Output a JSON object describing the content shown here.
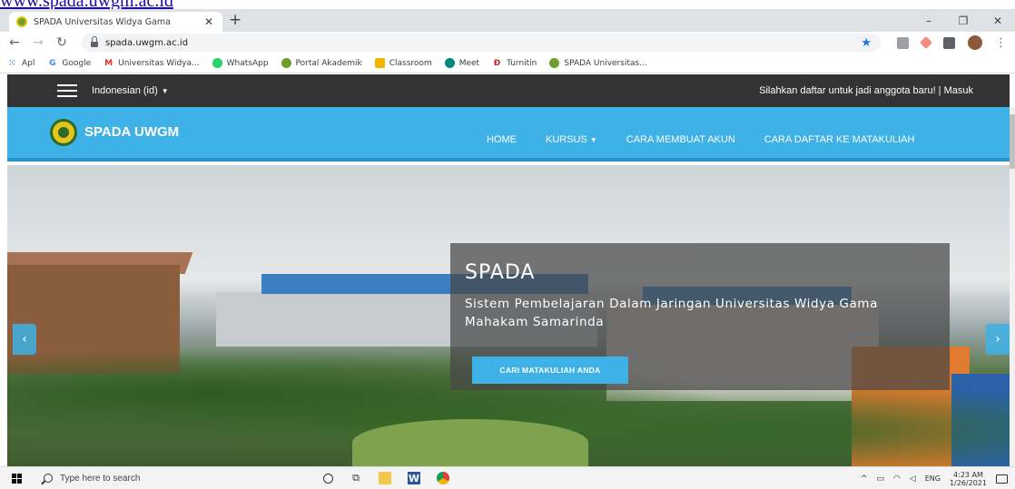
{
  "document": {
    "link_text": "www.spada.uwgm.ac.id"
  },
  "browser": {
    "tab": {
      "title": "SPADA Universitas Widya Gama"
    },
    "window_controls": [
      "–",
      "❐",
      "✕"
    ],
    "url": "spada.uwgm.ac.id",
    "bookmarks": [
      {
        "label": "Apl",
        "icon": "apps-grid-icon",
        "color": "#1a73e8"
      },
      {
        "label": "Google",
        "icon": "google-icon",
        "color": "#4285f4"
      },
      {
        "label": "Universitas Widya...",
        "icon": "gmail-icon",
        "color": "#d93025"
      },
      {
        "label": "WhatsApp",
        "icon": "whatsapp-icon",
        "color": "#25d366"
      },
      {
        "label": "Portal Akademik",
        "icon": "portal-icon",
        "color": "#6f9e2c"
      },
      {
        "label": "Classroom",
        "icon": "classroom-icon",
        "color": "#f2b600"
      },
      {
        "label": "Meet",
        "icon": "meet-icon",
        "color": "#00897b"
      },
      {
        "label": "Turnitin",
        "icon": "turnitin-icon",
        "color": "#c62828"
      },
      {
        "label": "SPADA Universitas...",
        "icon": "spada-icon",
        "color": "#6f9e2c"
      }
    ]
  },
  "site": {
    "topbar": {
      "language": "Indonesian (id)",
      "signup_text": "Silahkan daftar untuk jadi anggota baru! | Masuk"
    },
    "navbar": {
      "brand": "SPADA UWGM",
      "menu": [
        {
          "label": "HOME"
        },
        {
          "label": "KURSUS"
        },
        {
          "label": "CARA MEMBUAT AKUN"
        },
        {
          "label": "CARA DAFTAR KE MATAKULIAH"
        }
      ]
    },
    "hero": {
      "title": "SPADA",
      "subtitle": "Sistem Pembelajaran Dalam Jaringan Universitas Widya Gama Mahakam Samarinda",
      "cta": "CARI MATAKULIAH ANDA"
    },
    "colors": {
      "accent": "#3eb1e6",
      "topbar": "#333333"
    }
  },
  "taskbar": {
    "search_placeholder": "Type here to search",
    "tray_lang": "ENG",
    "time": "4:23 AM",
    "date": "1/26/2021"
  }
}
